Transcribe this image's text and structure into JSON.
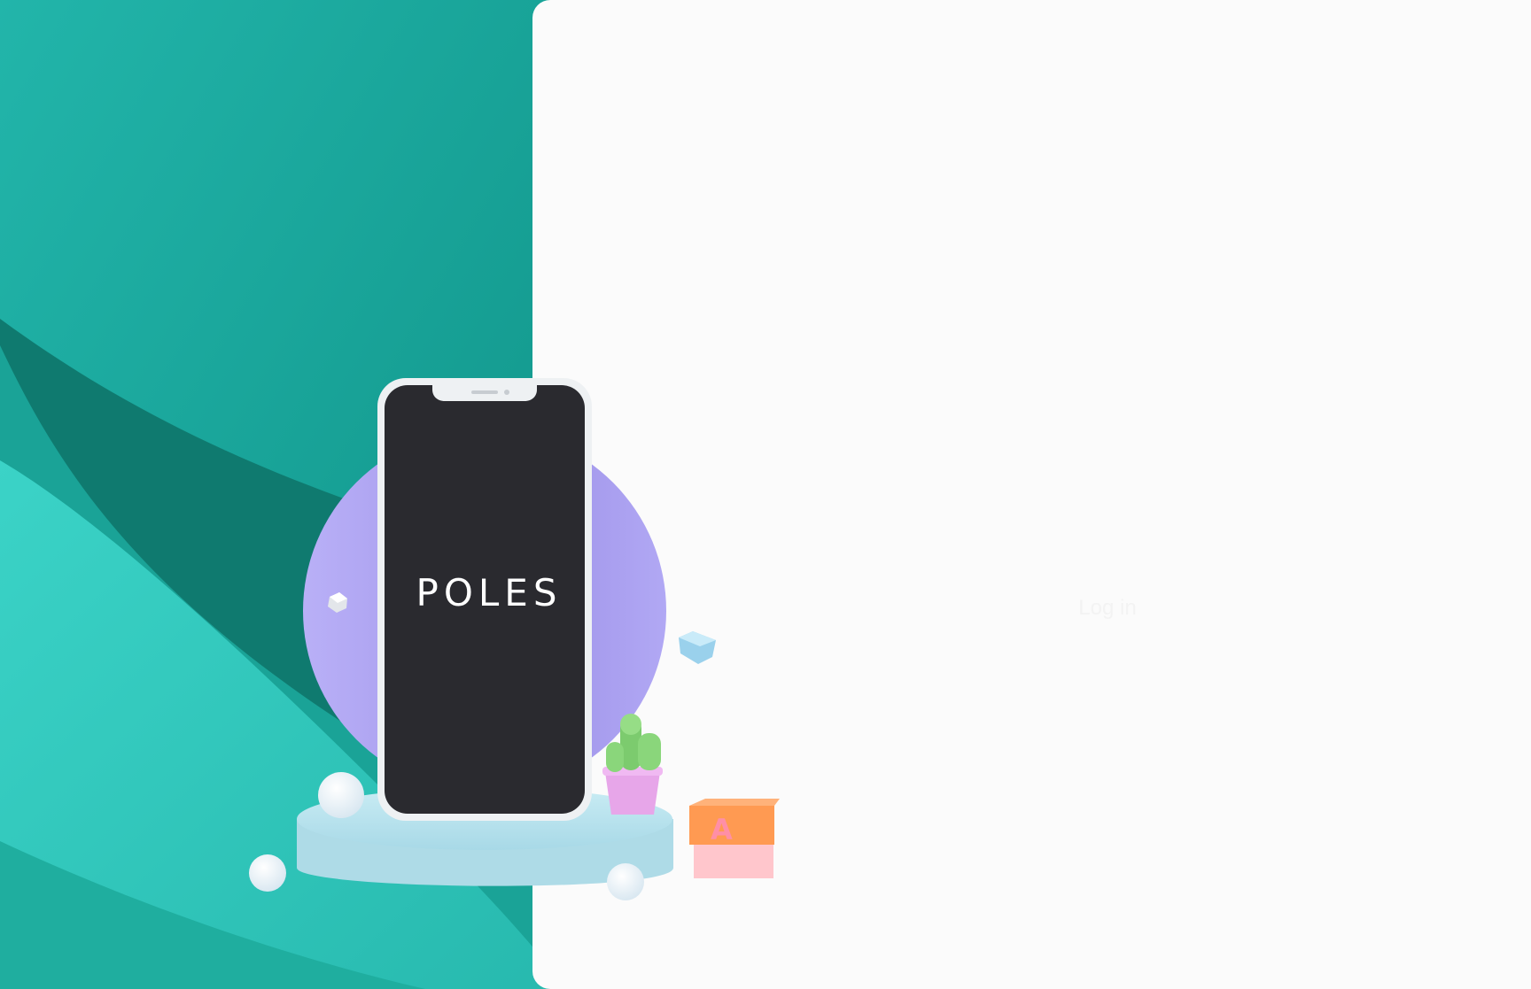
{
  "brand": {
    "logo_text": "POLES"
  },
  "login": {
    "button_label": "Log in"
  },
  "theme": {
    "teal_dark": "#0f7d72",
    "teal_mid": "#1ba79c",
    "teal_light": "#33cfc3",
    "panel_bg": "#fbfbfb",
    "circle_purple": "#a69cf0",
    "phone_screen": "#2a2a2f",
    "pedestal": "#b8e4ef"
  },
  "icons": {
    "phone": "phone-mockup-icon",
    "cactus": "cactus-plant-icon",
    "letter_block": "letter-a-block-icon",
    "cube": "cube-icon",
    "ball": "sphere-icon"
  }
}
